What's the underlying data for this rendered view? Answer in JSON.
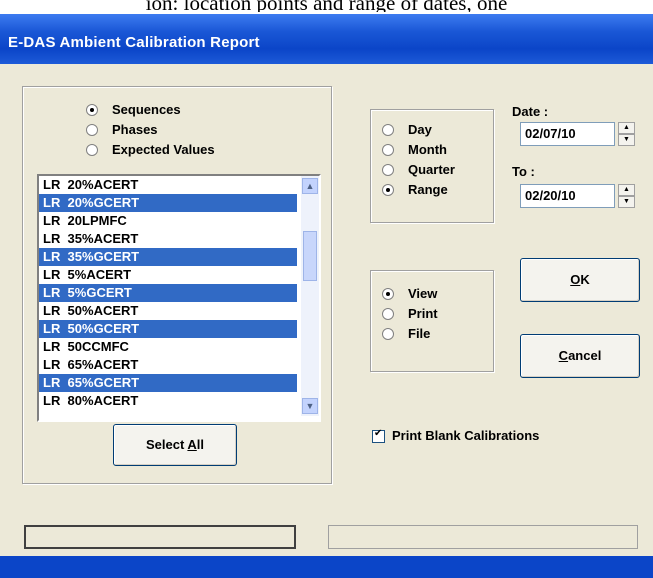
{
  "document": {
    "text_above": "ion: location points and range of dates, one"
  },
  "window": {
    "title": "E-DAS Ambient Calibration Report"
  },
  "list_type": {
    "options": [
      {
        "label": "Sequences",
        "selected": true
      },
      {
        "label": "Phases",
        "selected": false
      },
      {
        "label": "Expected Values",
        "selected": false
      }
    ]
  },
  "list": {
    "rows": [
      {
        "text": "LR  20%ACERT",
        "selected": false
      },
      {
        "text": "LR  20%GCERT",
        "selected": true
      },
      {
        "text": "LR  20LPMFC",
        "selected": false
      },
      {
        "text": "LR  35%ACERT",
        "selected": false
      },
      {
        "text": "LR  35%GCERT",
        "selected": true
      },
      {
        "text": "LR  5%ACERT",
        "selected": false
      },
      {
        "text": "LR  5%GCERT",
        "selected": true
      },
      {
        "text": "LR  50%ACERT",
        "selected": false
      },
      {
        "text": "LR  50%GCERT",
        "selected": true
      },
      {
        "text": "LR  50CCMFC",
        "selected": false
      },
      {
        "text": "LR  65%ACERT",
        "selected": false
      },
      {
        "text": "LR  65%GCERT",
        "selected": true
      },
      {
        "text": "LR  80%ACERT",
        "selected": false
      }
    ],
    "scroll_up_icon": "scroll-up-arrow",
    "scroll_down_icon": "scroll-down-arrow"
  },
  "select_all": {
    "label_pre": "Select ",
    "label_u": "A",
    "label_post": "ll"
  },
  "period": {
    "options": [
      {
        "label": "Day",
        "selected": false
      },
      {
        "label": "Month",
        "selected": false
      },
      {
        "label": "Quarter",
        "selected": false
      },
      {
        "label": "Range",
        "selected": true
      }
    ]
  },
  "date_from": {
    "label": "Date :",
    "value": "02/07/10"
  },
  "date_to": {
    "label": "To :",
    "value": "02/20/10"
  },
  "output": {
    "options": [
      {
        "label": "View",
        "selected": true
      },
      {
        "label": "Print",
        "selected": false
      },
      {
        "label": "File",
        "selected": false
      }
    ]
  },
  "ok_button": {
    "label_u": "O",
    "label_post": "K"
  },
  "cancel_button": {
    "label_u": "C",
    "label_post": "ancel"
  },
  "print_blank": {
    "label": "Print Blank Calibrations",
    "checked": true
  },
  "colors": {
    "titlebar": "#0b45c8",
    "selection": "#316ac5",
    "face": "#ece9d8"
  }
}
